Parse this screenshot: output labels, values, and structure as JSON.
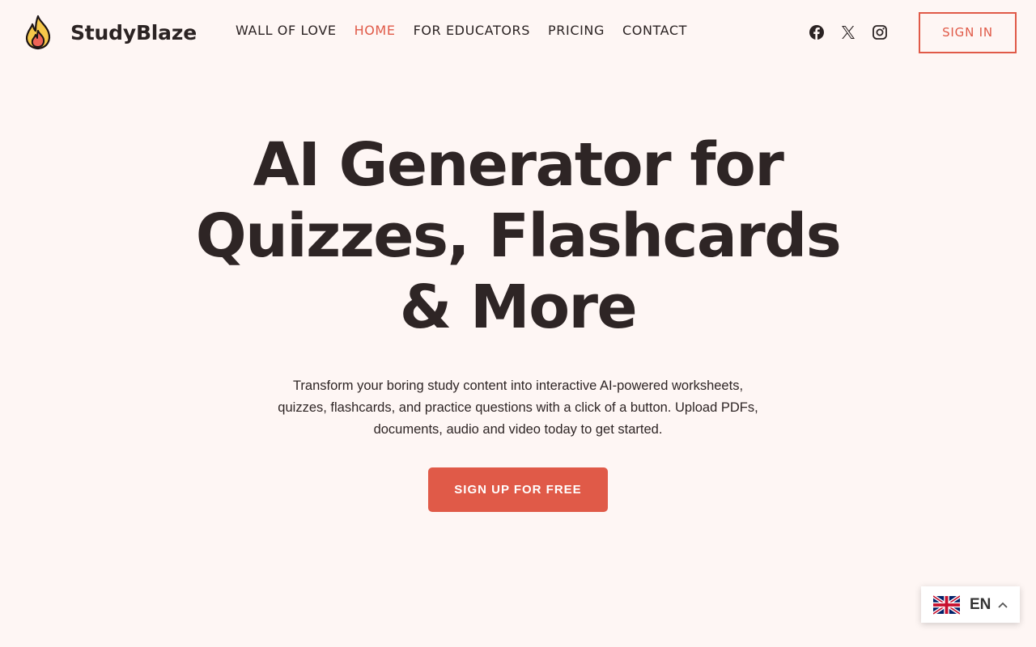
{
  "brand": {
    "name": "StudyBlaze",
    "icon": "flame-icon"
  },
  "nav": {
    "items": [
      {
        "label": "WALL OF LOVE",
        "active": false
      },
      {
        "label": "HOME",
        "active": true
      },
      {
        "label": "FOR EDUCATORS",
        "active": false
      },
      {
        "label": "PRICING",
        "active": false
      },
      {
        "label": "CONTACT",
        "active": false
      }
    ]
  },
  "socials": [
    "facebook-icon",
    "x-icon",
    "instagram-icon"
  ],
  "header": {
    "signin_label": "SIGN IN"
  },
  "hero": {
    "title_line1": "AI Generator for",
    "title_line2": "Quizzes, Flashcards",
    "title_line3": "& More",
    "subtitle": "Transform your boring study content into interactive AI-powered worksheets, quizzes, flashcards, and practice questions with a click of a button. Upload PDFs, documents, audio and video today to get started.",
    "cta_label": "SIGN UP FOR FREE"
  },
  "language": {
    "code": "EN",
    "flag": "uk-flag-icon"
  },
  "colors": {
    "accent": "#e05a48",
    "background": "#fef6f4",
    "text": "#2b2323"
  }
}
